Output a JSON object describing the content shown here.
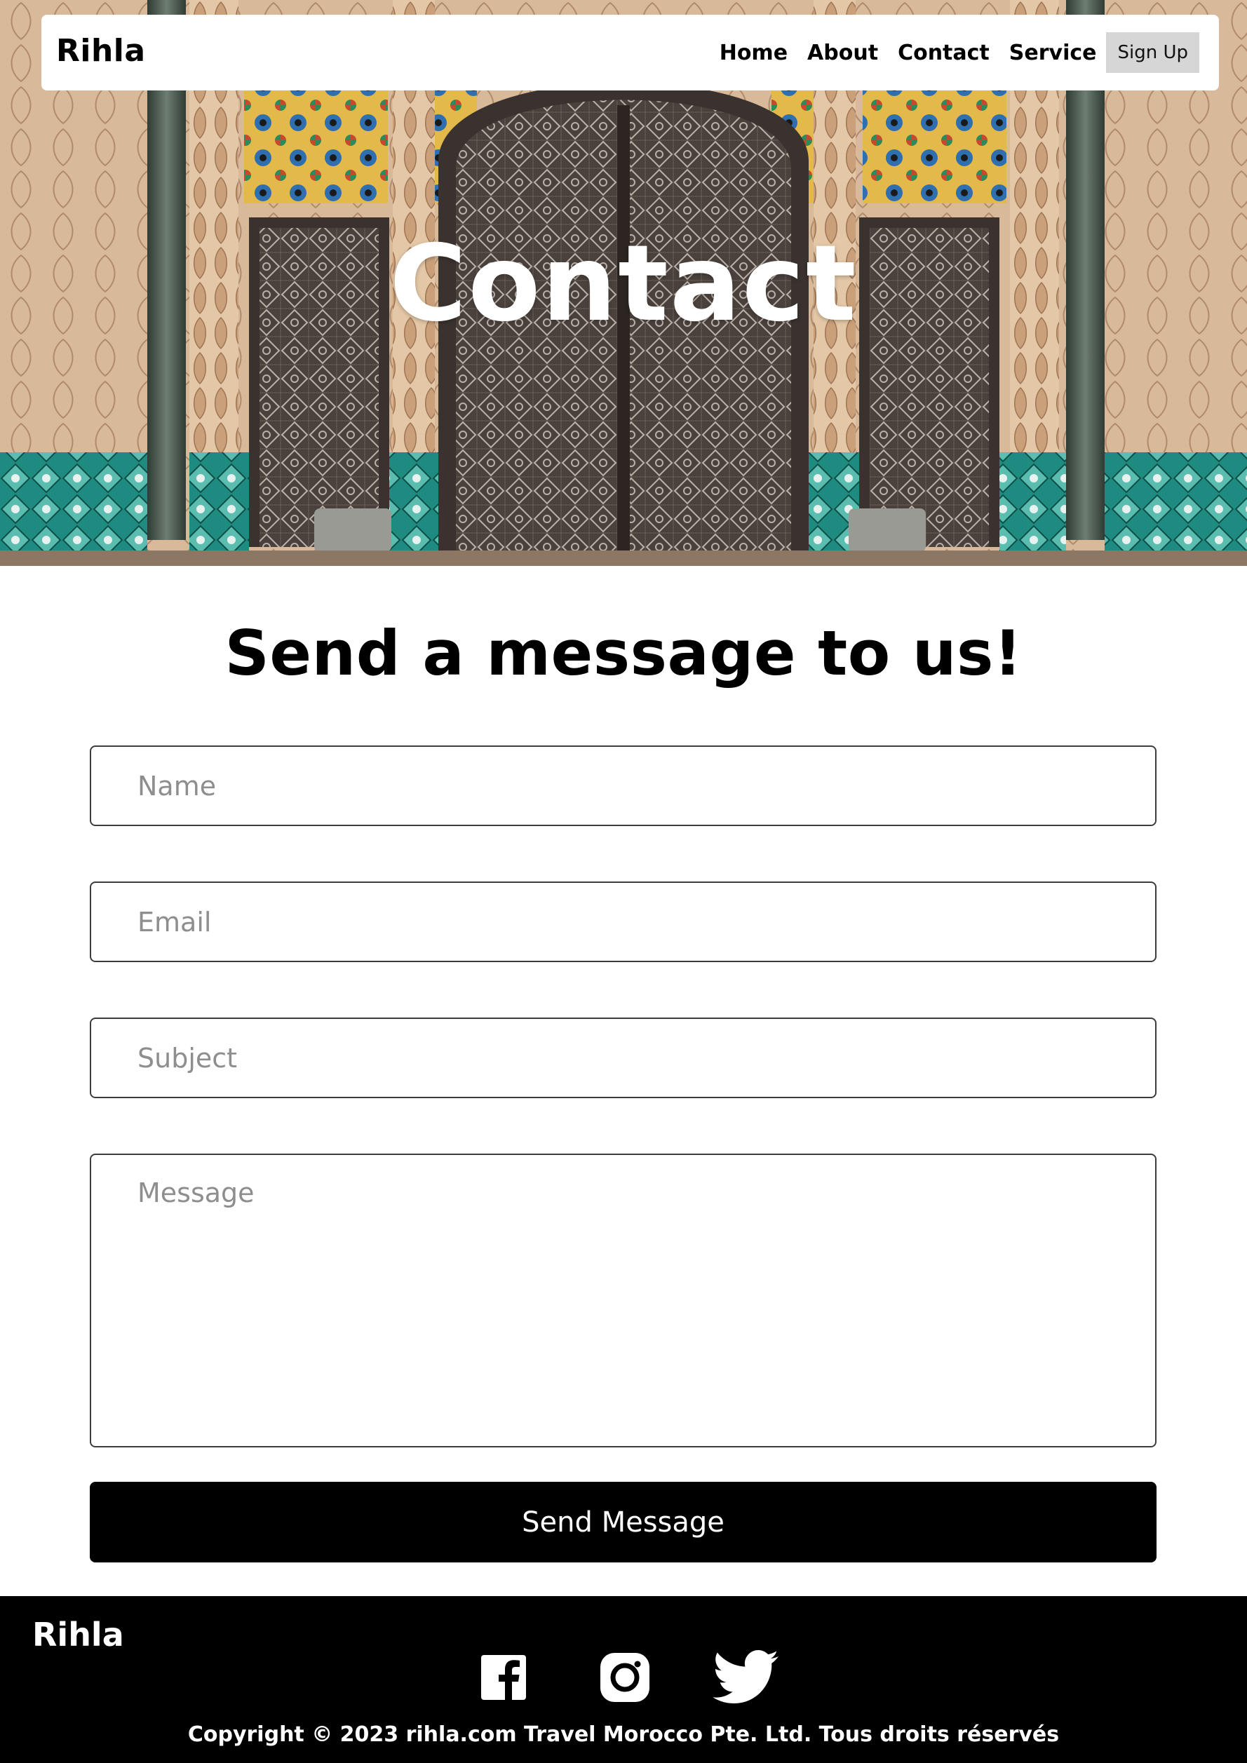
{
  "navbar": {
    "brand": "Rihla",
    "links": [
      "Home",
      "About",
      "Contact",
      "Service"
    ],
    "signup_label": "Sign Up"
  },
  "hero": {
    "title": "Contact"
  },
  "form": {
    "heading": "Send a message to us!",
    "name_placeholder": "Name",
    "email_placeholder": "Email",
    "subject_placeholder": "Subject",
    "message_placeholder": "Message",
    "submit_label": "Send Message"
  },
  "footer": {
    "brand": "Rihla",
    "social_icons": [
      "facebook-icon",
      "instagram-icon",
      "twitter-icon"
    ],
    "copyright": "Copyright © 2023 rihla.com Travel Morocco Pte. Ltd. Tous droits réservés"
  },
  "colors": {
    "accent": "#000000",
    "signup_bg": "#d6d6d6",
    "placeholder": "#8e8e8e",
    "footer_bg": "#000000"
  }
}
